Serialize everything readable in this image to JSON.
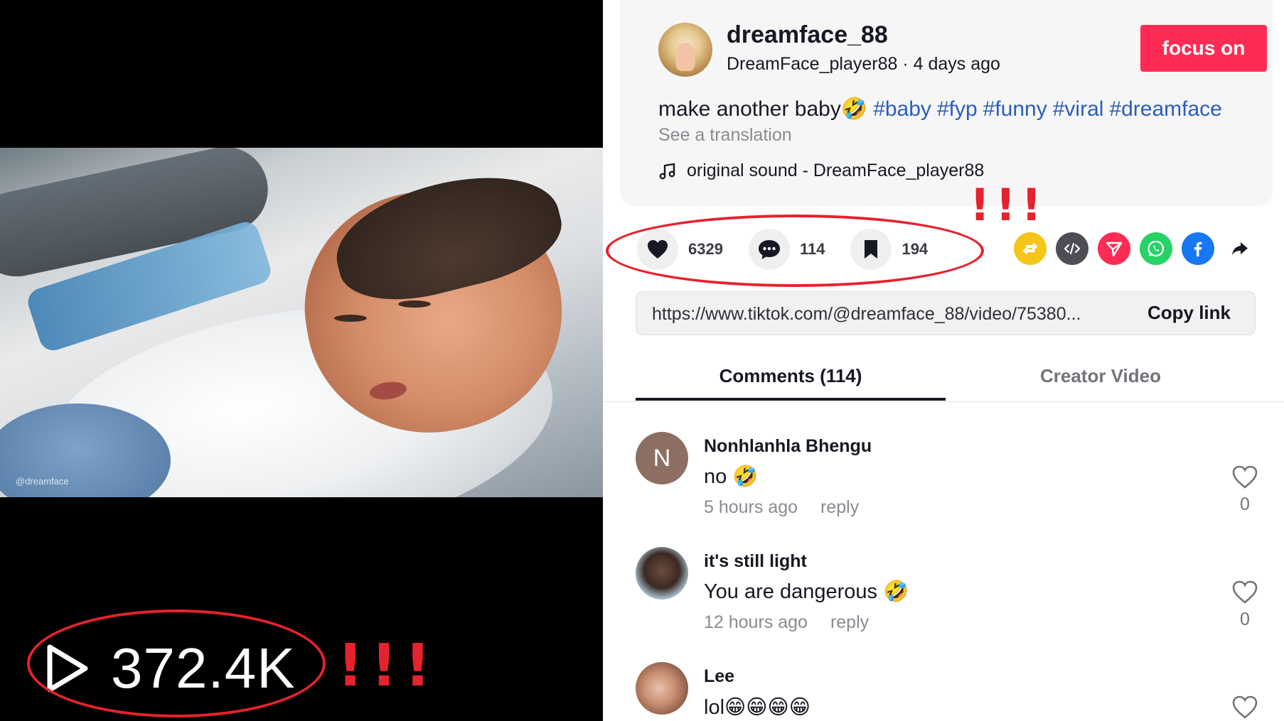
{
  "video": {
    "watermark": "@dreamface",
    "views": "372.4K",
    "annotation_marks": "!!!"
  },
  "author": {
    "username": "dreamface_88",
    "handle": "DreamFace_player88",
    "separator": "·",
    "posted": "4 days ago",
    "follow_label": "focus on"
  },
  "post": {
    "caption": "make another baby🤣",
    "hashtags": [
      "#baby",
      "#fyp",
      "#funny",
      "#viral",
      "#dreamface"
    ],
    "translate_label": "See a translation",
    "sound": "original sound - DreamFace_player88"
  },
  "stats": {
    "likes": "6329",
    "comments": "114",
    "saves": "194",
    "annotation_marks": "!!!"
  },
  "share_icons": [
    {
      "icon": "repost-icon",
      "color": "#f5c518"
    },
    {
      "icon": "embed-icon",
      "color": "#4d4e55"
    },
    {
      "icon": "send-icon",
      "color": "#fe2c55"
    },
    {
      "icon": "whatsapp-icon",
      "color": "#25d366"
    },
    {
      "icon": "facebook-icon",
      "color": "#1877f2"
    },
    {
      "icon": "share-arrow-icon",
      "color": "#161823"
    }
  ],
  "link": {
    "url": "https://www.tiktok.com/@dreamface_88/video/75380...",
    "copy_label": "Copy link"
  },
  "tabs": {
    "comments": "Comments (114)",
    "creator": "Creator Video"
  },
  "comments": [
    {
      "name": "Nonhlanhla Bhengu",
      "initial": "N",
      "text": "no 🤣",
      "time": "5 hours ago",
      "reply": "reply",
      "likes": "0"
    },
    {
      "name": "it's still light",
      "text": "You are dangerous 🤣",
      "time": "12 hours ago",
      "reply": "reply",
      "likes": "0"
    },
    {
      "name": "Lee",
      "text": "lol😁😁😁😁",
      "time": "",
      "reply": "",
      "likes": ""
    }
  ],
  "colors": {
    "accent": "#fe2c55",
    "annotation": "#e5222d",
    "hashtag": "#2b5db9"
  }
}
